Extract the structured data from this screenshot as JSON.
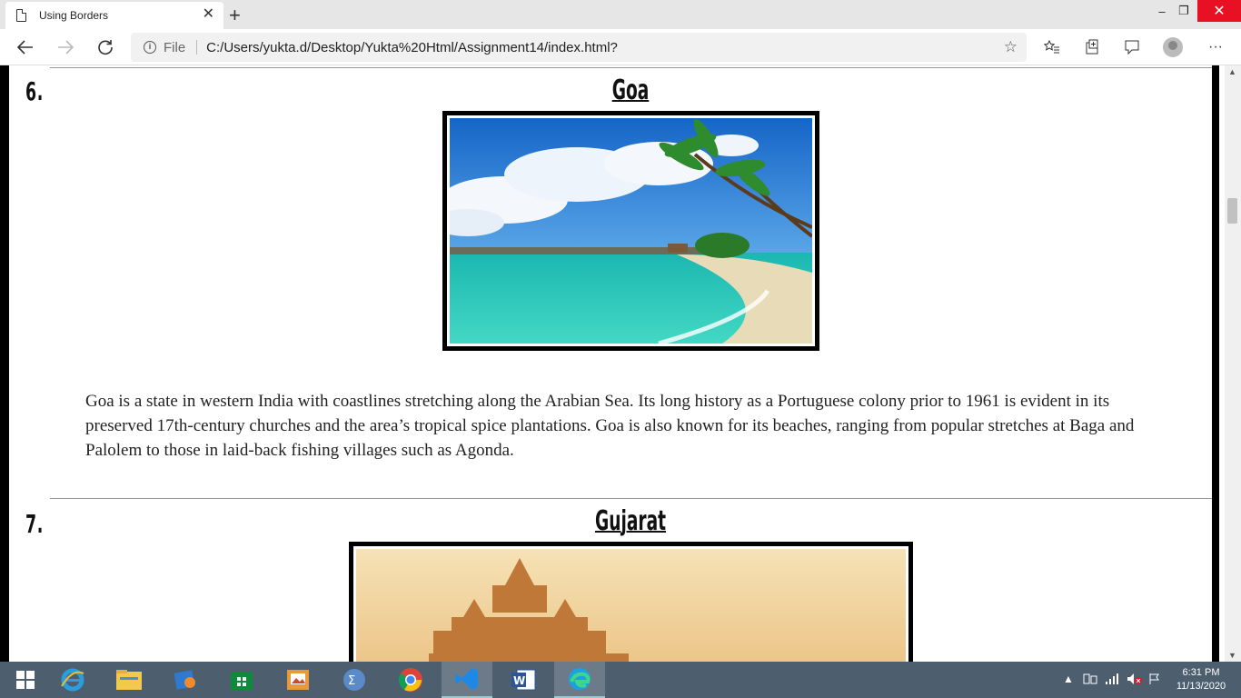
{
  "browser": {
    "tab_title": "Using Borders",
    "tab_close": "✕",
    "new_tab": "+",
    "address": {
      "file_label": "File",
      "url": "C:/Users/yukta.d/Desktop/Yukta%20Html/Assignment14/index.html?"
    },
    "window_controls": {
      "minimize": "–",
      "restore": "❐",
      "close": "✕"
    }
  },
  "page": {
    "sections": [
      {
        "number": "6.",
        "title": "Goa",
        "image_alt": "tropical beach with palm trees",
        "description": "Goa is a state in western India with coastlines stretching along the Arabian Sea. Its long history as a Portuguese colony prior to 1961 is evident in its preserved 17th-century churches and the area’s tropical spice plantations. Goa is also known for its beaches, ranging from popular stretches at Baga and Palolem to those in laid-back fishing villages such as Agonda."
      },
      {
        "number": "7.",
        "title": "Gujarat",
        "image_alt": "temple at sunset"
      }
    ]
  },
  "taskbar": {
    "apps": [
      "start",
      "internet-explorer",
      "file-explorer",
      "media",
      "store",
      "photos",
      "calculator",
      "chrome",
      "vscode",
      "word",
      "edge"
    ],
    "clock_time": "6:31 PM",
    "clock_date": "11/13/2020"
  },
  "colors": {
    "frame": "#000000",
    "taskbar": "#4d5f6f",
    "close_button": "#e81123"
  }
}
